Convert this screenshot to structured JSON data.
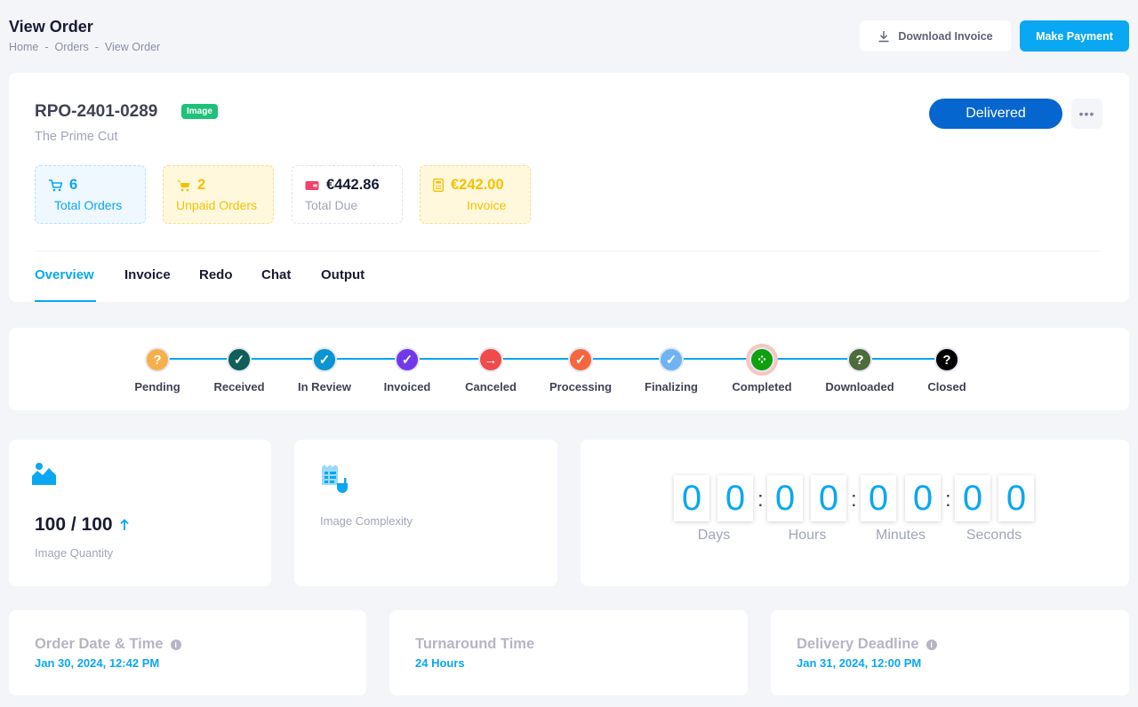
{
  "header": {
    "title": "View Order",
    "breadcrumb": [
      "Home",
      "-",
      "Orders",
      "-",
      "View Order"
    ],
    "download_invoice_label": "Download Invoice",
    "make_payment_label": "Make Payment"
  },
  "order": {
    "id": "RPO-2401-0289",
    "type_badge": "Image",
    "company": "The Prime Cut",
    "status": "Delivered",
    "more_label": "•••"
  },
  "stats": {
    "total_orders": {
      "value": "6",
      "label": "Total Orders",
      "color": "#0aa7f2"
    },
    "unpaid_orders": {
      "value": "2",
      "label": "Unpaid Orders",
      "color": "#f6c000"
    },
    "total_due": {
      "value": "€442.86",
      "label": "Total Due",
      "color": "#f1416c"
    },
    "invoice": {
      "value": "€242.00",
      "label": "Invoice",
      "color": "#f6c000"
    }
  },
  "tabs": [
    "Overview",
    "Invoice",
    "Redo",
    "Chat",
    "Output"
  ],
  "active_tab": "Overview",
  "steps": [
    {
      "label": "Pending",
      "icon": "question-icon",
      "glyph": "?",
      "color": "#f6b04a"
    },
    {
      "label": "Received",
      "icon": "check-icon",
      "glyph": "✓",
      "color": "#0f5e57"
    },
    {
      "label": "In Review",
      "icon": "check-icon",
      "glyph": "✓",
      "color": "#0b94d2"
    },
    {
      "label": "Invoiced",
      "icon": "check-icon",
      "glyph": "✓",
      "color": "#7239ea"
    },
    {
      "label": "Canceled",
      "icon": "arrow-right-icon",
      "glyph": "→",
      "color": "#f04a4a"
    },
    {
      "label": "Processing",
      "icon": "check-icon",
      "glyph": "✓",
      "color": "#f5683f"
    },
    {
      "label": "Finalizing",
      "icon": "check-icon",
      "glyph": "✓",
      "color": "#6fb3f3"
    },
    {
      "label": "Completed",
      "icon": "spinner-icon",
      "glyph": "⁘",
      "color": "#0fa10f"
    },
    {
      "label": "Downloaded",
      "icon": "question-icon",
      "glyph": "?",
      "color": "#4e6b3b"
    },
    {
      "label": "Closed",
      "icon": "question-icon",
      "glyph": "?",
      "color": "#000000"
    }
  ],
  "quantity": {
    "value": "100 / 100",
    "label": "Image Quantity"
  },
  "complexity": {
    "label": "Image Complexity"
  },
  "countdown": {
    "digits": [
      "0",
      "0",
      "0",
      "0",
      "0",
      "0",
      "0",
      "0"
    ],
    "separator": ":",
    "units": [
      "Days",
      "Hours",
      "Minutes",
      "Seconds"
    ]
  },
  "info": {
    "order_date": {
      "label": "Order Date & Time",
      "value": "Jan 30, 2024, 12:42 PM"
    },
    "turnaround": {
      "label": "Turnaround Time",
      "value": "24 Hours"
    },
    "deadline": {
      "label": "Delivery Deadline",
      "value": "Jan 31, 2024, 12:00 PM"
    }
  }
}
